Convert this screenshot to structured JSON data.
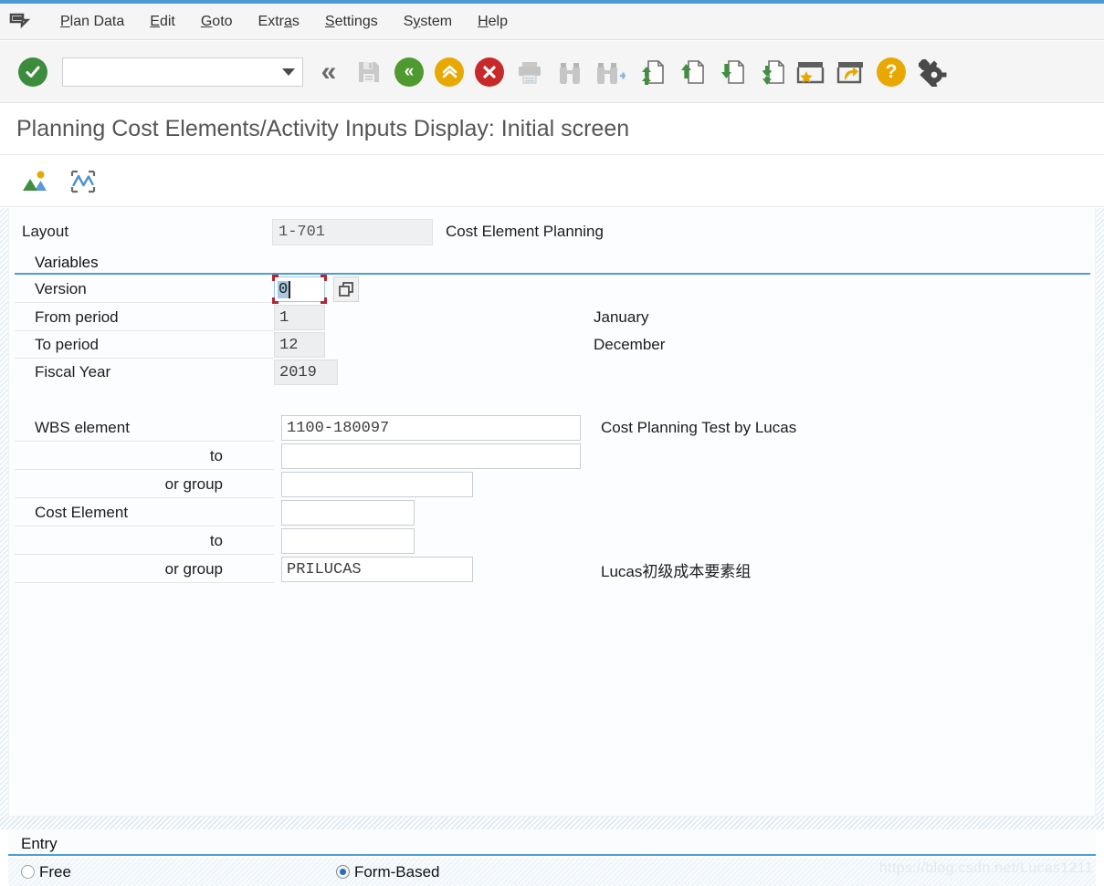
{
  "window": {
    "title": "Planning Cost Elements/Activity Inputs Display: Initial screen"
  },
  "menubar": {
    "system_icon": "sap-menu-icon",
    "items": [
      {
        "label": "Plan Data",
        "accel": "P"
      },
      {
        "label": "Edit",
        "accel": "E"
      },
      {
        "label": "Goto",
        "accel": "G"
      },
      {
        "label": "Extras",
        "accel": "a"
      },
      {
        "label": "Settings",
        "accel": "S"
      },
      {
        "label": "System",
        "accel": "y"
      },
      {
        "label": "Help",
        "accel": "H"
      }
    ]
  },
  "toolbar": {
    "command_field_value": "",
    "command_field_placeholder": "",
    "buttons": [
      {
        "name": "enter-button",
        "icon": "green-check-circle-icon",
        "enabled": true
      },
      {
        "name": "command-history-button",
        "icon": "double-chevron-left-icon",
        "enabled": true
      },
      {
        "name": "save-button",
        "icon": "floppy-disk-icon",
        "enabled": false
      },
      {
        "name": "back-button",
        "icon": "green-back-circle-icon",
        "enabled": true
      },
      {
        "name": "exit-button",
        "icon": "amber-up-circle-icon",
        "enabled": true
      },
      {
        "name": "cancel-button",
        "icon": "red-cancel-circle-icon",
        "enabled": true
      },
      {
        "name": "print-button",
        "icon": "printer-icon",
        "enabled": false
      },
      {
        "name": "find-button",
        "icon": "binoculars-icon",
        "enabled": false
      },
      {
        "name": "find-next-button",
        "icon": "binoculars-plus-icon",
        "enabled": false
      },
      {
        "name": "first-page-button",
        "icon": "page-double-up-icon",
        "enabled": true
      },
      {
        "name": "previous-page-button",
        "icon": "page-up-icon",
        "enabled": true
      },
      {
        "name": "next-page-button",
        "icon": "page-down-icon",
        "enabled": true
      },
      {
        "name": "last-page-button",
        "icon": "page-double-down-icon",
        "enabled": true
      },
      {
        "name": "create-session-button",
        "icon": "window-star-icon",
        "enabled": true
      },
      {
        "name": "create-shortcut-button",
        "icon": "window-arrow-icon",
        "enabled": true
      },
      {
        "name": "help-button",
        "icon": "question-circle-icon",
        "enabled": true
      },
      {
        "name": "customize-local-layout-button",
        "icon": "gear-icon",
        "enabled": true
      }
    ]
  },
  "app_toolbar": {
    "buttons": [
      {
        "name": "overview-screen-button",
        "icon": "picture-landscape-icon"
      },
      {
        "name": "planner-profile-button",
        "icon": "line-chart-icon"
      }
    ]
  },
  "form": {
    "layout": {
      "label": "Layout",
      "value": "1-701",
      "description": "Cost Element Planning"
    },
    "variables_group": {
      "title": "Variables",
      "fields": [
        {
          "name": "version",
          "label": "Version",
          "value": "0",
          "description": "",
          "focused": true,
          "has_matchcode": true
        },
        {
          "name": "from-period",
          "label": "From period",
          "value": "1",
          "description": "January"
        },
        {
          "name": "to-period",
          "label": "To period",
          "value": "12",
          "description": "December"
        },
        {
          "name": "fiscal-year",
          "label": "Fiscal Year",
          "value": "2019",
          "description": ""
        }
      ]
    },
    "selection_fields": [
      {
        "name": "wbs-element",
        "label": "WBS element",
        "value": "1100-180097",
        "description": "Cost Planning Test by Lucas"
      },
      {
        "name": "wbs-element-to",
        "label": "to",
        "value": "",
        "description": ""
      },
      {
        "name": "wbs-element-group",
        "label": "or group",
        "value": "",
        "description": ""
      },
      {
        "name": "cost-element",
        "label": "Cost Element",
        "value": "",
        "description": ""
      },
      {
        "name": "cost-element-to",
        "label": "to",
        "value": "",
        "description": ""
      },
      {
        "name": "cost-element-group",
        "label": "or group",
        "value": "PRILUCAS",
        "description": "Lucas初级成本要素组"
      }
    ]
  },
  "entry": {
    "title": "Entry",
    "options": [
      {
        "name": "entry-free",
        "label": "Free",
        "selected": false
      },
      {
        "name": "entry-form-based",
        "label": "Form-Based",
        "selected": true
      }
    ]
  },
  "watermark": {
    "text": "https://blog.csdn.net/Lucas1211"
  },
  "colors": {
    "accent_blue": "#4b9fd5",
    "green": "#3d8b3d",
    "amber": "#e8a800",
    "red": "#c7282a",
    "focus_red": "#b3252f",
    "selection_blue": "#a8c8e4"
  }
}
